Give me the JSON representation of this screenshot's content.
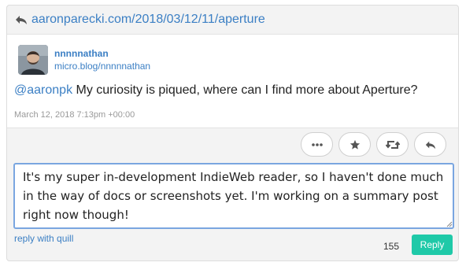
{
  "header": {
    "link_text": "aaronparecki.com/2018/03/12/11/aperture"
  },
  "post": {
    "author_name": "nnnnnathan",
    "author_url": "micro.blog/nnnnnathan",
    "mention": "@aaronpk",
    "text": " My curiosity is piqued, where can I find more about Aperture?",
    "timestamp": "March 12, 2018 7:13pm +00:00"
  },
  "actions": [
    {
      "icon": "ellipsis-icon"
    },
    {
      "icon": "star-icon"
    },
    {
      "icon": "repost-icon"
    },
    {
      "icon": "reply-icon"
    }
  ],
  "reply": {
    "text": "It's my super in-development IndieWeb reader, so I haven't done much in the way of docs or screenshots yet. I'm working on a summary post right now though!",
    "quill_link": "reply with quill",
    "char_count": "155",
    "button_label": "Reply"
  },
  "colors": {
    "link": "#3b7fc4",
    "reply_button": "#1fc9a8",
    "focus_border": "#7aa6e0"
  }
}
